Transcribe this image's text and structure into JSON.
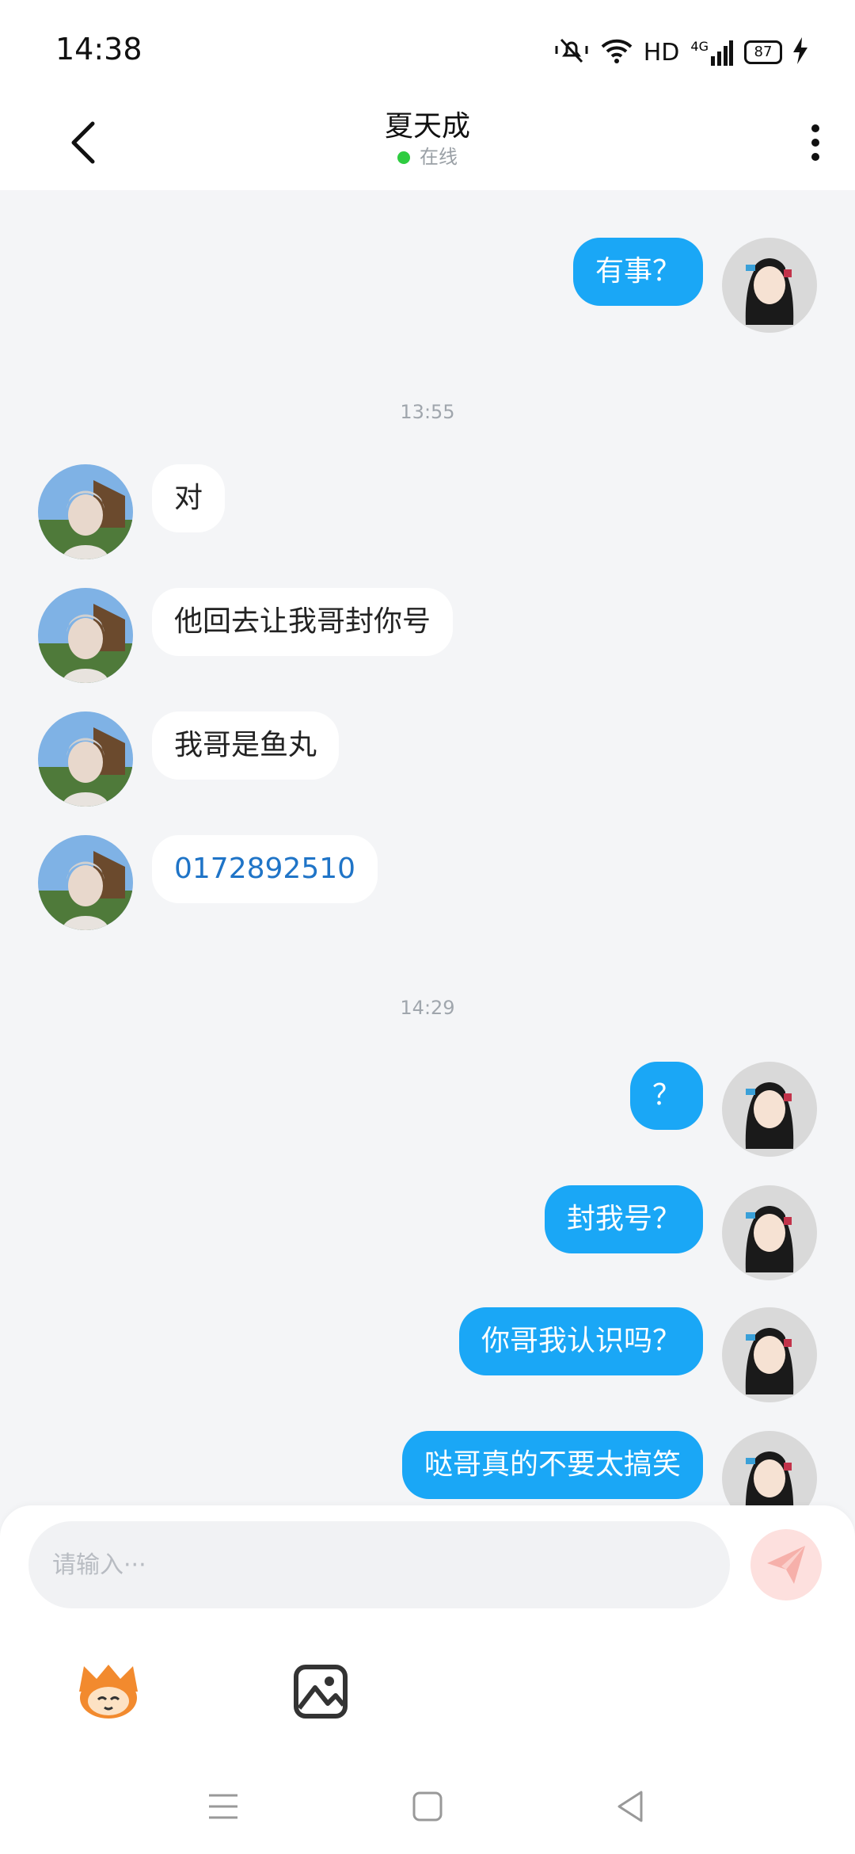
{
  "status_bar": {
    "time": "14:38",
    "hd_label": "HD",
    "network_label": "4G",
    "battery": "87"
  },
  "header": {
    "title": "夏天成",
    "presence": "在线"
  },
  "messages": [
    {
      "dir": "out",
      "text": "有事？"
    },
    {
      "dir": "in",
      "text": "对"
    },
    {
      "dir": "in",
      "text": "他回去让我哥封你号"
    },
    {
      "dir": "in",
      "text": "我哥是鱼丸"
    },
    {
      "dir": "in",
      "text": "0172892510"
    },
    {
      "dir": "out",
      "text": "？"
    },
    {
      "dir": "out",
      "text": "封我号？"
    },
    {
      "dir": "out",
      "text": "你哥我认识吗？"
    },
    {
      "dir": "out",
      "text": "哒哥真的不要太搞笑"
    }
  ],
  "timestamps": [
    "13:55",
    "14:29"
  ],
  "composer": {
    "placeholder": "请输入···",
    "send_icon": "send-icon",
    "tools": [
      "emoji-mascot-icon",
      "image-icon"
    ]
  },
  "nav": [
    "menu-icon",
    "home-icon",
    "back-icon"
  ],
  "colors": {
    "outgoing_bubble": "#1aa7f6",
    "incoming_bubble": "#ffffff",
    "background": "#f4f5f7",
    "online_dot": "#2ecc40",
    "send_button": "#fde0de"
  }
}
